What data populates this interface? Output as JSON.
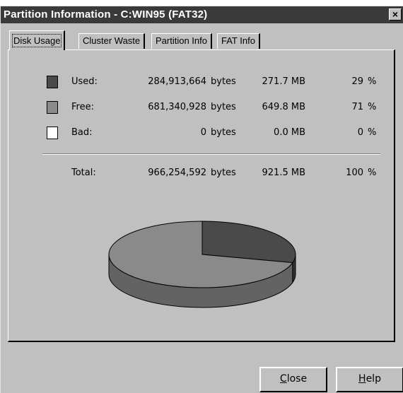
{
  "window": {
    "title": "Partition Information - C:WIN95 (FAT32)",
    "close_glyph": "×"
  },
  "tabs": [
    {
      "label": "Disk Usage",
      "active": true
    },
    {
      "label": "Cluster Waste",
      "active": false
    },
    {
      "label": "Partition Info",
      "active": false
    },
    {
      "label": "FAT Info",
      "active": false
    }
  ],
  "usage": {
    "rows": [
      {
        "label": "Used:",
        "bytes": "284,913,664",
        "bytes_unit": "bytes",
        "mb": "271.7 MB",
        "percent": "29",
        "percent_unit": "%",
        "color": "#4a4a4a"
      },
      {
        "label": "Free:",
        "bytes": "681,340,928",
        "bytes_unit": "bytes",
        "mb": "649.8 MB",
        "percent": "71",
        "percent_unit": "%",
        "color": "#8a8a8a"
      },
      {
        "label": "Bad:",
        "bytes": "0",
        "bytes_unit": "bytes",
        "mb": "0.0 MB",
        "percent": "0",
        "percent_unit": "%",
        "color": "#ffffff"
      }
    ],
    "total": {
      "label": "Total:",
      "bytes": "966,254,592",
      "bytes_unit": "bytes",
      "mb": "921.5 MB",
      "percent": "100",
      "percent_unit": "%"
    }
  },
  "chart_data": {
    "type": "pie",
    "categories": [
      "Used",
      "Free",
      "Bad"
    ],
    "values": [
      29,
      71,
      0
    ],
    "colors": [
      "#4a4a4a",
      "#8a8a8a",
      "#ffffff"
    ]
  },
  "buttons": {
    "close": {
      "label": "Close",
      "mnemonic": "C"
    },
    "help": {
      "label": "Help",
      "mnemonic": "H"
    }
  }
}
